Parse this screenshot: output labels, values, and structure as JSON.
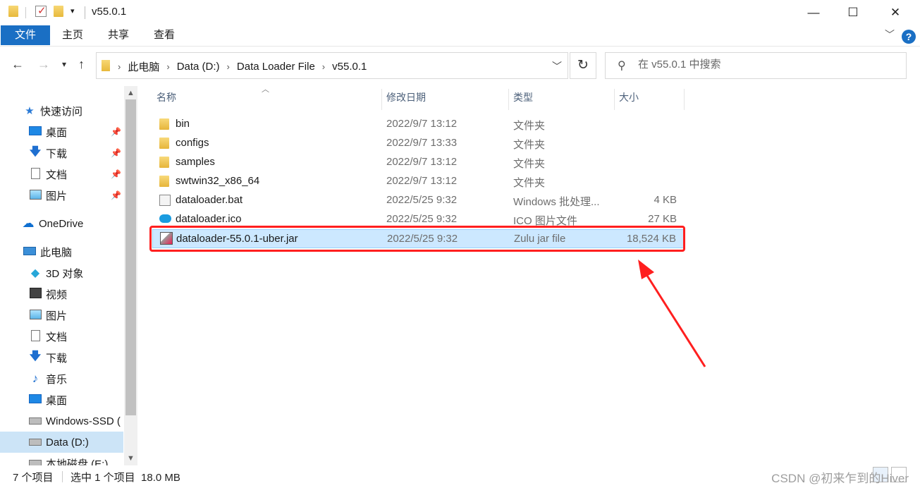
{
  "window": {
    "title": "v55.0.1",
    "controls": {
      "minimize": "—",
      "maximize": "☐",
      "close": "✕"
    }
  },
  "ribbon": {
    "tabs": [
      "文件",
      "主页",
      "共享",
      "查看"
    ],
    "help": "?"
  },
  "address": {
    "breadcrumbs": [
      "此电脑",
      "Data (D:)",
      "Data Loader File",
      "v55.0.1"
    ],
    "search_placeholder": "在 v55.0.1 中搜索"
  },
  "nav": {
    "items": [
      {
        "label": "快速访问",
        "icon": "star-icon",
        "pinned": false
      },
      {
        "label": "桌面",
        "icon": "desktop-icon",
        "pinned": true
      },
      {
        "label": "下载",
        "icon": "download-icon",
        "pinned": true
      },
      {
        "label": "文档",
        "icon": "document-icon",
        "pinned": true
      },
      {
        "label": "图片",
        "icon": "picture-icon",
        "pinned": true
      },
      {
        "label": "OneDrive",
        "icon": "cloud-icon",
        "pinned": false
      },
      {
        "label": "此电脑",
        "icon": "computer-icon",
        "pinned": false
      },
      {
        "label": "3D 对象",
        "icon": "cube-icon",
        "pinned": false
      },
      {
        "label": "视频",
        "icon": "video-icon",
        "pinned": false
      },
      {
        "label": "图片",
        "icon": "picture-icon",
        "pinned": false
      },
      {
        "label": "文档",
        "icon": "document-icon",
        "pinned": false
      },
      {
        "label": "下载",
        "icon": "download-icon",
        "pinned": false
      },
      {
        "label": "音乐",
        "icon": "music-icon",
        "pinned": false
      },
      {
        "label": "桌面",
        "icon": "desktop-icon",
        "pinned": false
      },
      {
        "label": "Windows-SSD (",
        "icon": "drive-icon",
        "pinned": false
      },
      {
        "label": "Data (D:)",
        "icon": "drive-icon",
        "pinned": false,
        "selected": true
      },
      {
        "label": "本地磁盘 (E:)",
        "icon": "drive-icon",
        "pinned": false
      }
    ]
  },
  "columns": {
    "name": "名称",
    "date": "修改日期",
    "type": "类型",
    "size": "大小"
  },
  "files": [
    {
      "name": "bin",
      "date": "2022/9/7 13:12",
      "type": "文件夹",
      "size": "",
      "icon": "folder-icon"
    },
    {
      "name": "configs",
      "date": "2022/9/7 13:33",
      "type": "文件夹",
      "size": "",
      "icon": "folder-icon"
    },
    {
      "name": "samples",
      "date": "2022/9/7 13:12",
      "type": "文件夹",
      "size": "",
      "icon": "folder-icon"
    },
    {
      "name": "swtwin32_x86_64",
      "date": "2022/9/7 13:12",
      "type": "文件夹",
      "size": "",
      "icon": "folder-icon"
    },
    {
      "name": "dataloader.bat",
      "date": "2022/5/25 9:32",
      "type": "Windows 批处理...",
      "size": "4 KB",
      "icon": "batch-file-icon"
    },
    {
      "name": "dataloader.ico",
      "date": "2022/5/25 9:32",
      "type": "ICO 图片文件",
      "size": "27 KB",
      "icon": "ico-file-icon"
    },
    {
      "name": "dataloader-55.0.1-uber.jar",
      "date": "2022/5/25 9:32",
      "type": "Zulu jar file",
      "size": "18,524 KB",
      "icon": "jar-file-icon",
      "selected": true
    }
  ],
  "status": {
    "item_count": "7 个项目",
    "selection": "选中 1 个项目  18.0 MB",
    "watermark": "CSDN @初来乍到的Hiver"
  },
  "colors": {
    "accent": "#1a6fc4",
    "selection": "#cce8ff",
    "annotation": "#ff1f1f"
  }
}
